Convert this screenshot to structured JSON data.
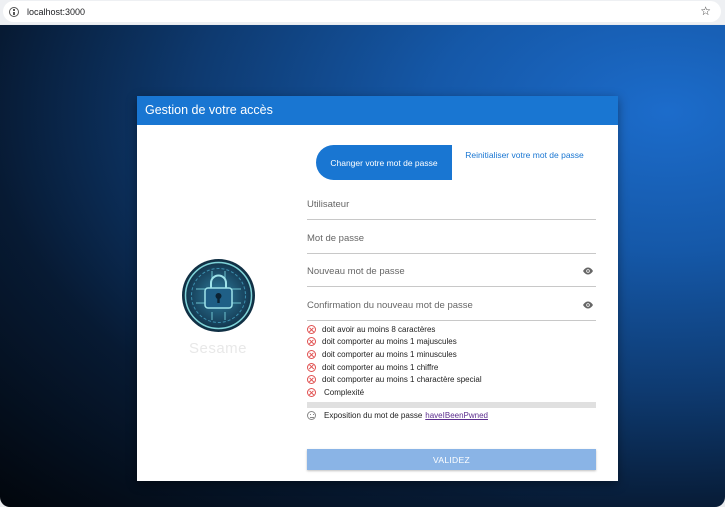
{
  "browser": {
    "url": "localhost:3000"
  },
  "dialog": {
    "title": "Gestion de votre accès",
    "logo_text": "Sesame"
  },
  "tabs": [
    {
      "label": "Changer votre mot de passe",
      "active": true
    },
    {
      "label": "Reinitialiser votre mot de passe",
      "active": false
    }
  ],
  "fields": {
    "username": {
      "label": "Utilisateur",
      "value": ""
    },
    "password": {
      "label": "Mot de passe",
      "value": ""
    },
    "new_password": {
      "label": "Nouveau mot de passe",
      "value": ""
    },
    "confirm_password": {
      "label": "Confirmation du nouveau mot de passe",
      "value": ""
    }
  },
  "rules": [
    {
      "text": "doit avoir au moins 8 caractères",
      "status": "failed"
    },
    {
      "text": "doit comporter au moins 1 majuscules",
      "status": "failed"
    },
    {
      "text": "doit comporter au moins 1 minuscules",
      "status": "failed"
    },
    {
      "text": "doit comporter au moins 1 chiffre",
      "status": "failed"
    },
    {
      "text": "doit comporter au moins 1 charactère special",
      "status": "failed"
    },
    {
      "text": "Complexité",
      "status": "failed"
    }
  ],
  "complexity_progress": 0,
  "exposure": {
    "text": "Exposition du mot de passe",
    "link_text": "haveIBeenPwned"
  },
  "validate_button": {
    "label": "VALIDEZ",
    "disabled": true
  },
  "colors": {
    "primary": "#1976d2",
    "error": "#e05050",
    "link": "#5b2d8e"
  }
}
